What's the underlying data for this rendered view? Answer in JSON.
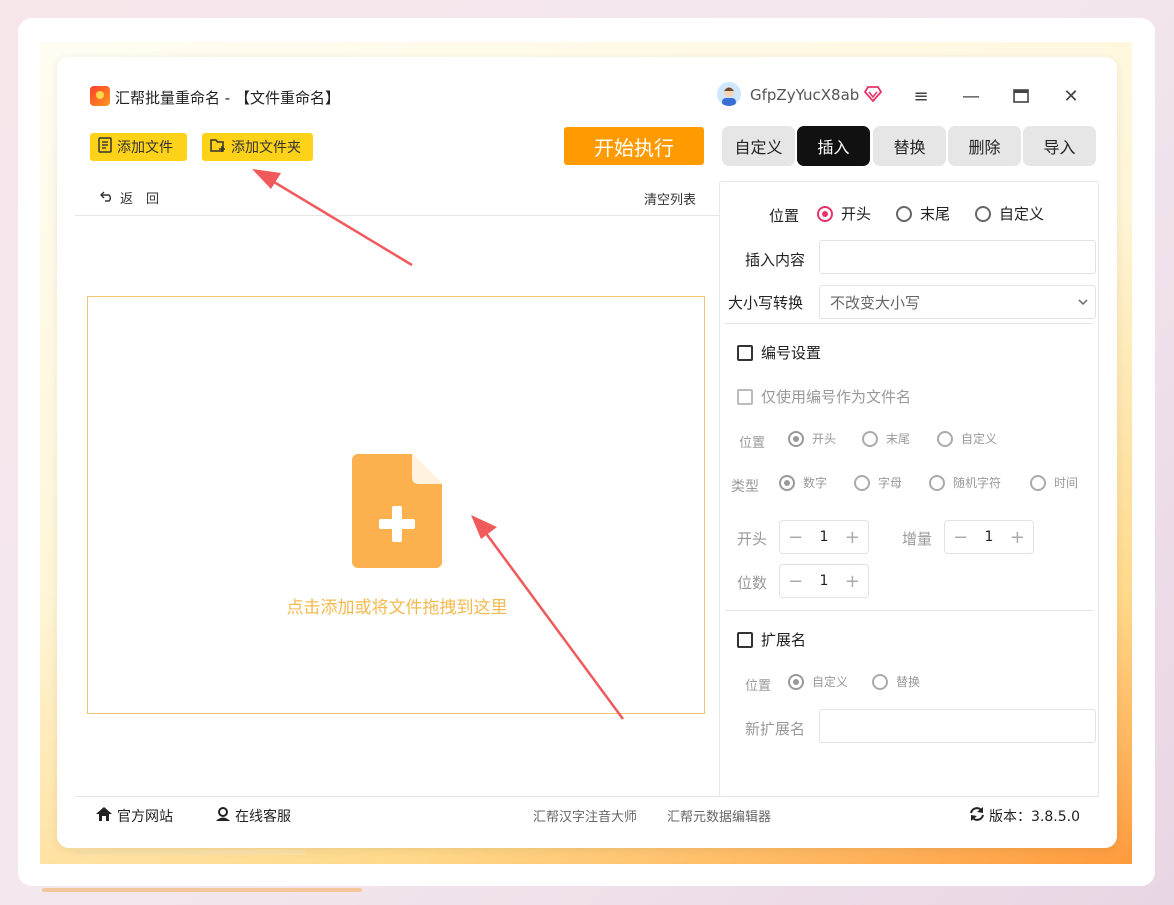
{
  "window": {
    "title": "汇帮批量重命名 - 【文件重命名】",
    "username": "GfpZyYucX8ab",
    "accent": "#ff9a00"
  },
  "toolbar": {
    "add_file": "添加文件",
    "add_folder": "添加文件夹",
    "start": "开始执行"
  },
  "tabs": [
    {
      "label": "自定义",
      "active": false
    },
    {
      "label": "插入",
      "active": true
    },
    {
      "label": "替换",
      "active": false
    },
    {
      "label": "删除",
      "active": false
    },
    {
      "label": "导入",
      "active": false
    }
  ],
  "list": {
    "back": "返　回",
    "clear": "清空列表",
    "drop_hint": "点击添加或将文件拖拽到这里"
  },
  "insert": {
    "position_label": "位置",
    "position_options": [
      "开头",
      "末尾",
      "自定义"
    ],
    "content_label": "插入内容",
    "content_value": "",
    "case_label": "大小写转换",
    "case_value": "不改变大小写"
  },
  "numbering": {
    "title": "编号设置",
    "only_number": "仅使用编号作为文件名",
    "position_label": "位置",
    "position_options": [
      "开头",
      "末尾",
      "自定义"
    ],
    "type_label": "类型",
    "type_options": [
      "数字",
      "字母",
      "随机字符",
      "时间"
    ],
    "start_label": "开头",
    "start_value": "1",
    "increment_label": "增量",
    "increment_value": "1",
    "digits_label": "位数",
    "digits_value": "1"
  },
  "extension": {
    "title": "扩展名",
    "position_label": "位置",
    "position_options": [
      "自定义",
      "替换"
    ],
    "new_label": "新扩展名",
    "new_value": ""
  },
  "footer": {
    "website": "官方网站",
    "service": "在线客服",
    "link1": "汇帮汉字注音大师",
    "link2": "汇帮元数据编辑器",
    "version": "版本：3.8.5.0"
  }
}
